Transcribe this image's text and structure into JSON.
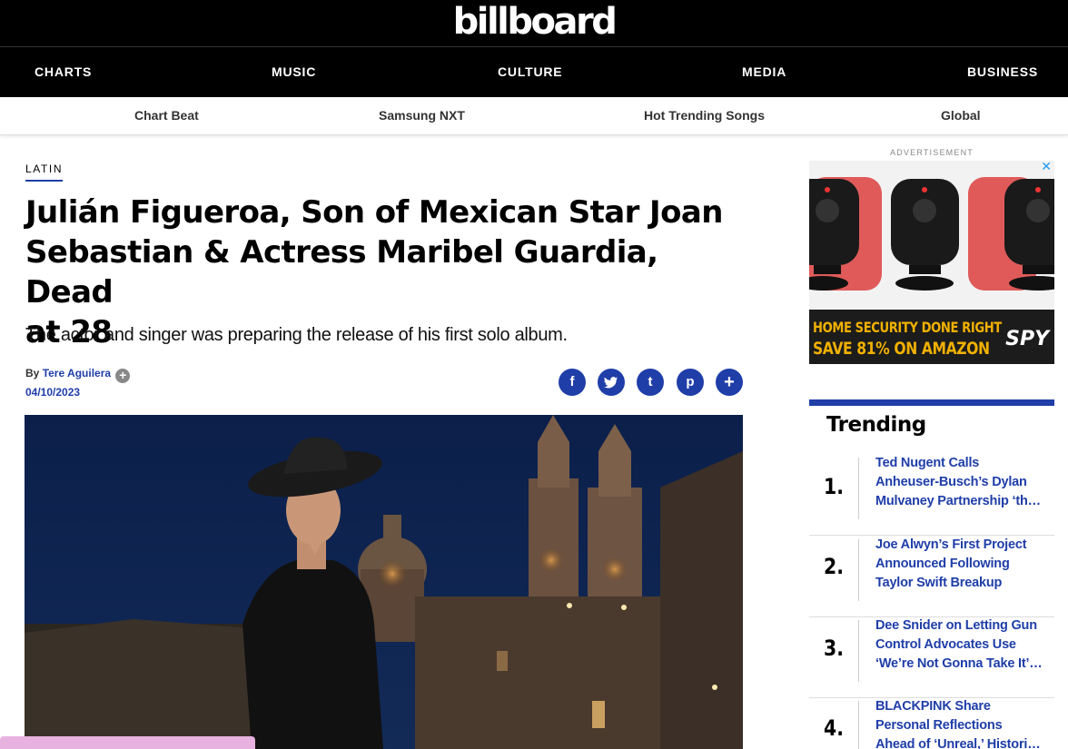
{
  "header": {
    "logo": "billboard",
    "nav": [
      {
        "label": "CHARTS"
      },
      {
        "label": "MUSIC"
      },
      {
        "label": "CULTURE"
      },
      {
        "label": "MEDIA"
      },
      {
        "label": "BUSINESS"
      }
    ],
    "subnav": [
      {
        "label": "Chart Beat"
      },
      {
        "label": "Samsung NXT"
      },
      {
        "label": "Hot Trending Songs"
      },
      {
        "label": "Global"
      }
    ]
  },
  "article": {
    "category": "LATIN",
    "headline_lines": [
      "Julián Figueroa, Son of Mexican Star Joan",
      "Sebastian & Actress Maribel Guardia, Dead",
      "at 28"
    ],
    "dek": "The actor and singer was preparing the release of his first solo album.",
    "byline_prefix": "By",
    "author": "Tere Aguilera",
    "author_more": "+",
    "date": "04/10/2023",
    "share": [
      {
        "icon": "facebook-icon",
        "glyph": "f"
      },
      {
        "icon": "twitter-icon",
        "glyph": "t"
      },
      {
        "icon": "tumblr-icon",
        "glyph": "t"
      },
      {
        "icon": "pinterest-icon",
        "glyph": "p"
      },
      {
        "icon": "more-icon",
        "glyph": "+"
      }
    ]
  },
  "sidebar": {
    "ad_label": "ADVERTISEMENT",
    "ad": {
      "close": "✕",
      "line1": "HOME SECURITY DONE RIGHT",
      "line2": "SAVE 81% ON AMAZON",
      "brand": "SPY"
    },
    "trending": {
      "title": "Trending",
      "items": [
        {
          "num": "1.",
          "text": "Ted Nugent Calls Anheuser-Busch’s Dylan Mulvaney Partnership ‘th…"
        },
        {
          "num": "2.",
          "text": "Joe Alwyn’s First Project Announced Following Taylor Swift Breakup"
        },
        {
          "num": "3.",
          "text": "Dee Snider on Letting Gun Control Advocates Use ‘We’re Not Gonna Take It’…"
        },
        {
          "num": "4.",
          "text": "BLACKPINK Share Personal Reflections Ahead of ‘Unreal,’ Histori…"
        }
      ]
    }
  },
  "colors": {
    "brand_blue": "#1f3ea8",
    "header_bg": "#000000",
    "ad_yellow": "#f0b000"
  }
}
